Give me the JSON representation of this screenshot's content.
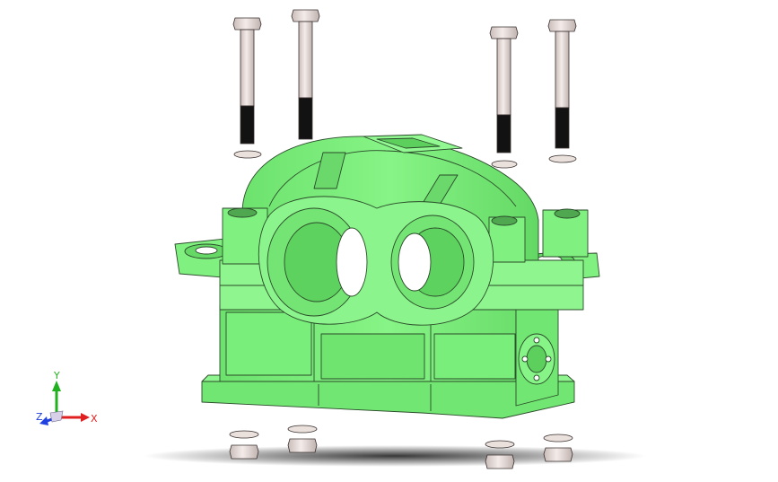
{
  "viewport": {
    "background": "#ffffff",
    "part_color": "#7ff07f",
    "part_edge_color": "#2a4a2a",
    "bolt_color": "#e8dcd8",
    "thread_color": "#111111",
    "shadow_color": "#2b2b2b"
  },
  "triad": {
    "x_label": "X",
    "y_label": "Y",
    "z_label": "Z",
    "x_color": "#e02020",
    "y_color": "#20b020",
    "z_color": "#2040e0"
  }
}
